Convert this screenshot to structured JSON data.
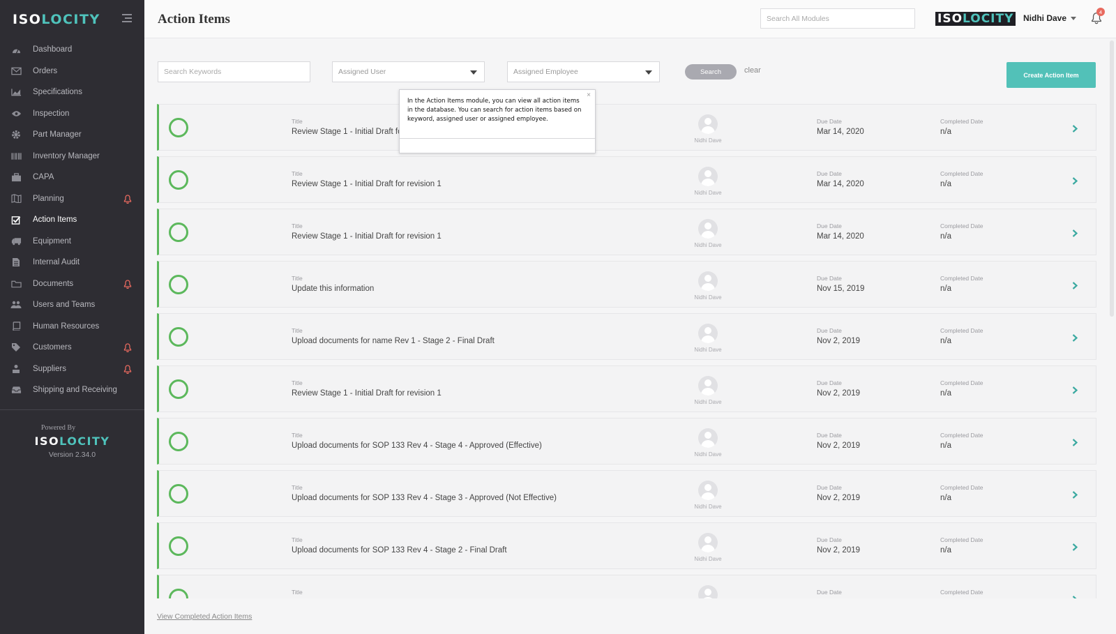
{
  "brand": {
    "iso": "ISO",
    "locity": "LOCITY"
  },
  "sidebar": {
    "items": [
      {
        "label": "Dashboard",
        "icon": "dashboard-icon",
        "bell": false
      },
      {
        "label": "Orders",
        "icon": "envelope-icon",
        "bell": false
      },
      {
        "label": "Specifications",
        "icon": "chart-area-icon",
        "bell": false
      },
      {
        "label": "Inspection",
        "icon": "eye-icon",
        "bell": false
      },
      {
        "label": "Part Manager",
        "icon": "gear-icon",
        "bell": false
      },
      {
        "label": "Inventory Manager",
        "icon": "barcode-icon",
        "bell": false
      },
      {
        "label": "CAPA",
        "icon": "briefcase-icon",
        "bell": false
      },
      {
        "label": "Planning",
        "icon": "map-icon",
        "bell": true
      },
      {
        "label": "Action Items",
        "icon": "checkbox-icon",
        "bell": false,
        "active": true
      },
      {
        "label": "Equipment",
        "icon": "truck-icon",
        "bell": false
      },
      {
        "label": "Internal Audit",
        "icon": "file-icon",
        "bell": false
      },
      {
        "label": "Documents",
        "icon": "folder-icon",
        "bell": true
      },
      {
        "label": "Users and Teams",
        "icon": "users-icon",
        "bell": false
      },
      {
        "label": "Human Resources",
        "icon": "book-icon",
        "bell": false
      },
      {
        "label": "Customers",
        "icon": "tag-icon",
        "bell": true
      },
      {
        "label": "Suppliers",
        "icon": "supplier-icon",
        "bell": true
      },
      {
        "label": "Shipping and Receiving",
        "icon": "inbox-icon",
        "bell": false
      }
    ],
    "powered_by": "Powered By",
    "version": "Version 2.34.0"
  },
  "header": {
    "title": "Action Items",
    "search_placeholder": "Search All Modules",
    "user_name": "Nidhi Dave",
    "notification_count": "4"
  },
  "filters": {
    "keywords_placeholder": "Search Keywords",
    "assigned_user": "Assigned User",
    "assigned_employee": "Assigned Employee",
    "search_label": "Search",
    "clear_label": "clear",
    "create_label": "Create Action Item"
  },
  "tooltip": {
    "text": "In the Action Items module, you can view all action items in the database. You can search for action items based on keyword, assigned user or assigned employee.",
    "close": "×"
  },
  "labels": {
    "title": "Title",
    "due_date": "Due Date",
    "completed_date": "Completed Date"
  },
  "rows": [
    {
      "title": "Review Stage 1 - Initial Draft for revision 1",
      "assignee": "Nidhi Dave",
      "due": "Mar 14, 2020",
      "completed": "n/a"
    },
    {
      "title": "Review Stage 1 - Initial Draft for revision 1",
      "assignee": "Nidhi Dave",
      "due": "Mar 14, 2020",
      "completed": "n/a"
    },
    {
      "title": "Review Stage 1 - Initial Draft for revision 1",
      "assignee": "Nidhi Dave",
      "due": "Mar 14, 2020",
      "completed": "n/a"
    },
    {
      "title": "Update this information",
      "assignee": "Nidhi Dave",
      "due": "Nov 15, 2019",
      "completed": "n/a"
    },
    {
      "title": "Upload documents for name Rev 1 - Stage 2 - Final Draft",
      "assignee": "Nidhi Dave",
      "due": "Nov 2, 2019",
      "completed": "n/a"
    },
    {
      "title": "Review Stage 1 - Initial Draft for revision 1",
      "assignee": "Nidhi Dave",
      "due": "Nov 2, 2019",
      "completed": "n/a"
    },
    {
      "title": "Upload documents for SOP 133 Rev 4 - Stage 4 - Approved (Effective)",
      "assignee": "Nidhi Dave",
      "due": "Nov 2, 2019",
      "completed": "n/a"
    },
    {
      "title": "Upload documents for SOP 133 Rev 4 - Stage 3 - Approved (Not Effective)",
      "assignee": "Nidhi Dave",
      "due": "Nov 2, 2019",
      "completed": "n/a"
    },
    {
      "title": "Upload documents for SOP 133 Rev 4 - Stage 2 - Final Draft",
      "assignee": "Nidhi Dave",
      "due": "Nov 2, 2019",
      "completed": "n/a"
    },
    {
      "title": "",
      "assignee": "",
      "due": "",
      "completed": ""
    }
  ],
  "footer": {
    "view_completed": "View Completed Action Items"
  },
  "colors": {
    "sidebar_bg": "#2e2d33",
    "accent": "#52c1b8",
    "status_green": "#5cb85c",
    "alert_red": "#e86a5f"
  }
}
